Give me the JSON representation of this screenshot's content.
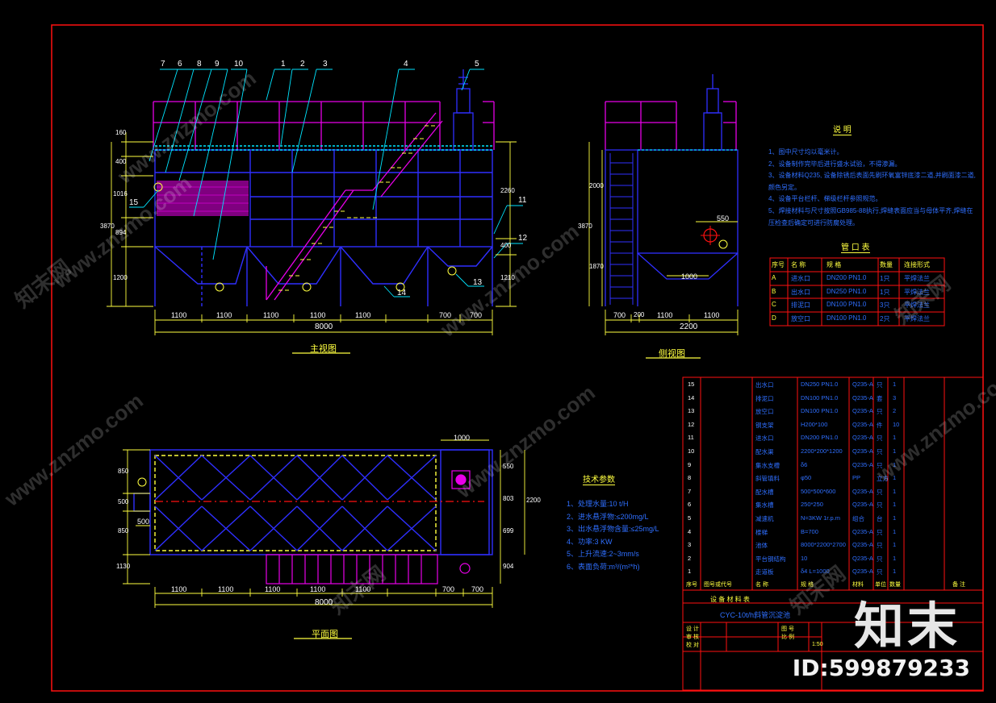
{
  "watermark": {
    "site": "www.znzmo.com",
    "cn": "知末网",
    "brand": "知末",
    "id": "ID:599879233"
  },
  "views": {
    "front": {
      "title": "主视图",
      "dims_bottom": [
        "1100",
        "1100",
        "1100",
        "1100",
        "1100",
        "700",
        "700"
      ],
      "total": "8000",
      "dims_left": [
        "160",
        "400",
        "1016",
        "894",
        "1200"
      ],
      "total_left": "3870",
      "right_dims": [
        "2260",
        "400",
        "1210"
      ]
    },
    "side": {
      "title": "侧视图",
      "dims_bottom": [
        "700",
        "200",
        "1100",
        "1100"
      ],
      "total": "2200",
      "left_dims": [
        "2000",
        "1870"
      ],
      "total_left": "3870",
      "inner_dims": [
        "550",
        "1000"
      ]
    },
    "plan": {
      "title": "平面图",
      "dims_bottom": [
        "1100",
        "1100",
        "1100",
        "1100",
        "1100",
        "700",
        "700"
      ],
      "total": "8000",
      "dims_left": [
        "850",
        "500",
        "850",
        "1130"
      ],
      "right_dims": [
        "550",
        "803",
        "699",
        "904"
      ],
      "total_right": "2200",
      "top_dim": "1000",
      "inlet_dim": "500"
    }
  },
  "balloons": [
    "7",
    "6",
    "8",
    "9",
    "10",
    "1",
    "2",
    "3",
    "4",
    "5",
    "11",
    "12",
    "13",
    "14",
    "15"
  ],
  "notes": {
    "title": "说  明",
    "items": [
      "1、图中尺寸均以毫米计。",
      "2、设备制作完毕后进行盛水试验，不得渗漏。",
      "3、设备材料Q235, 设备除锈后表面先刷环氧富锌底漆二道,并刷面漆二道,颜色另定。",
      "4、设备平台栏杆、梯级栏杆参照规范。",
      "5、焊接材料与尺寸按照GB985-88执行,焊缝表面应当与母体平齐,焊缝在压检查后确定可进行防腐处理。"
    ]
  },
  "nozzle_table": {
    "title": "管  口  表",
    "headers": [
      "序号",
      "名  称",
      "规    格",
      "数量",
      "连接形式"
    ],
    "rows": [
      [
        "A",
        "进水口",
        "DN200  PN1.0",
        "1只",
        "平焊法兰"
      ],
      [
        "B",
        "出水口",
        "DN250  PN1.0",
        "1只",
        "平焊法兰"
      ],
      [
        "C",
        "排泥口",
        "DN100  PN1.0",
        "3只",
        "平焊法兰"
      ],
      [
        "D",
        "放空口",
        "DN100  PN1.0",
        "2只",
        "平焊法兰"
      ]
    ]
  },
  "tech": {
    "title": "技术参数",
    "items": [
      "1、处理水量:10 t/H",
      "2、进水悬浮物:≤200mg/L",
      "3、出水悬浮物含量:≤25mg/L",
      "4、功率:3 KW",
      "5、上升流速:2~3mm/s",
      "6、表面负荷:m³/(m²*h)"
    ]
  },
  "bom": {
    "rows": [
      [
        "15",
        "出水口",
        "DN250  PN1.0",
        "Q235-A",
        "只",
        "1"
      ],
      [
        "14",
        "排泥口",
        "DN100  PN1.0",
        "Q235-A",
        "套",
        "3"
      ],
      [
        "13",
        "放空口",
        "DN100  PN1.0",
        "Q235-A",
        "只",
        "2"
      ],
      [
        "12",
        "钢支架",
        "H200*100",
        "Q235-A",
        "件",
        "10"
      ],
      [
        "11",
        "进水口",
        "DN200  PN1.0",
        "Q235-A",
        "只",
        "1"
      ],
      [
        "10",
        "配水渠",
        "2200*200*1200",
        "Q235-A",
        "只",
        "1"
      ],
      [
        "9",
        "集水支槽",
        "δ6",
        "Q235-A",
        "只",
        "1"
      ],
      [
        "8",
        "斜管填料",
        "φ50",
        "PP",
        "立方",
        "1"
      ],
      [
        "7",
        "配水槽",
        "500*500*600",
        "Q235-A",
        "只",
        "1"
      ],
      [
        "6",
        "集水槽",
        "250*250",
        "Q235-A",
        "只",
        "1"
      ],
      [
        "5",
        "减速机",
        "N=3KW  1r.p.m",
        "组合",
        "台",
        "1"
      ],
      [
        "4",
        "楼梯",
        "B=700",
        "Q235-A",
        "只",
        "1"
      ],
      [
        "3",
        "池体",
        "8000*2200*2700",
        "Q235-A",
        "只",
        "1"
      ],
      [
        "2",
        "平台钢结构",
        "10",
        "Q235-A",
        "只",
        "1"
      ],
      [
        "1",
        "走道板",
        "δ4  L=1000",
        "Q235-A",
        "只",
        "1"
      ]
    ],
    "headers": [
      "序号",
      "图号或代号",
      "名  称",
      "规  格",
      "材料",
      "单位",
      "数量",
      "备  注"
    ],
    "caption": "设  备  材  料  表",
    "product": "CYC-10t/h斜管沉淀池",
    "sign_rows": [
      "设 计",
      "审 核",
      "校 对",
      "图 号",
      "比 例",
      "1:50"
    ]
  },
  "colors": {
    "frame": "#ff1010",
    "blue": "#2f2fff",
    "magenta": "#e800e8",
    "yellow": "#ffff40",
    "cyan": "#00e5ff",
    "white": "#ffffff",
    "green": "#00ff60",
    "orange": "#ff7a00"
  }
}
